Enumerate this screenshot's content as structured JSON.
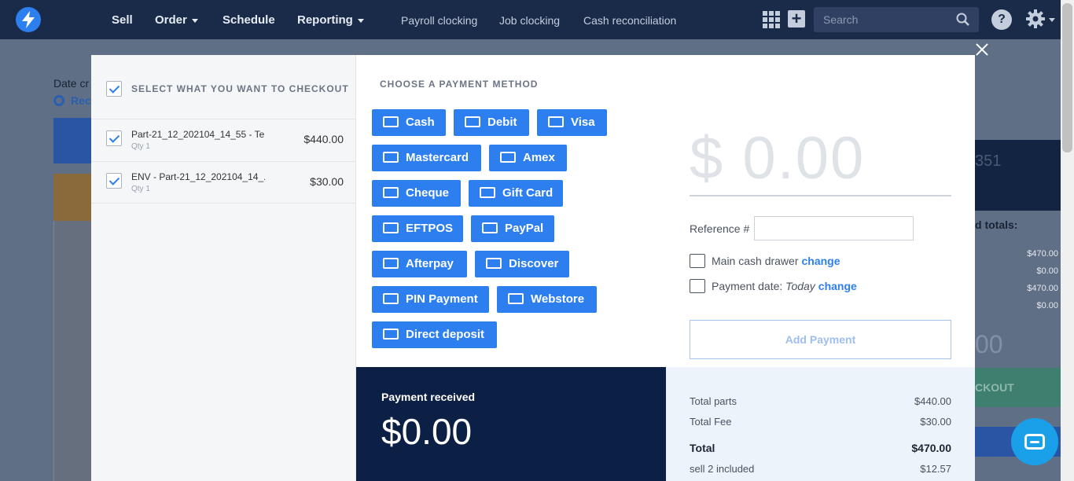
{
  "nav": {
    "main": [
      "Sell",
      "Order",
      "Schedule",
      "Reporting"
    ],
    "sub": [
      "Payroll clocking",
      "Job clocking",
      "Cash reconciliation"
    ],
    "search_placeholder": "Search"
  },
  "background": {
    "date_label": "Date cr",
    "recent_label": "Rec",
    "num_fragment": "351",
    "totals_label": "d totals:",
    "values": [
      "$470.00",
      "$0.00",
      "$470.00",
      "$0.00"
    ],
    "big_fragment": "00",
    "checkout_fragment": "CKOUT"
  },
  "checkout": {
    "heading": "SELECT WHAT YOU WANT TO CHECKOUT",
    "items": [
      {
        "name": "Part-21_12_202104_14_55 - Te...",
        "qty": "Qty 1",
        "price": "$440.00"
      },
      {
        "name": "ENV - Part-21_12_202104_14_...",
        "qty": "Qty 1",
        "price": "$30.00"
      }
    ]
  },
  "payment": {
    "heading": "CHOOSE A PAYMENT METHOD",
    "methods": [
      "Cash",
      "Debit",
      "Visa",
      "Mastercard",
      "Amex",
      "Cheque",
      "Gift Card",
      "EFTPOS",
      "PayPal",
      "Afterpay",
      "Discover",
      "PIN Payment",
      "Webstore",
      "Direct deposit"
    ],
    "amount": "$ 0.00",
    "reference_label": "Reference  #",
    "reference_value": "",
    "drawer_label": "Main cash drawer",
    "change_label": "change",
    "date_prefix": "Payment date:",
    "date_value": "Today",
    "add_payment_label": "Add Payment"
  },
  "received": {
    "label": "Payment received",
    "value": "$0.00"
  },
  "totals": [
    {
      "label": "Total parts",
      "value": "$440.00"
    },
    {
      "label": "Total Fee",
      "value": "$30.00"
    },
    {
      "label": "Total",
      "value": "$470.00"
    },
    {
      "label": "sell 2 included",
      "value": "$12.57"
    }
  ],
  "colors": {
    "accent": "#2d7ff0",
    "nav": "#1a2b4a",
    "received_bg": "#0c1f45"
  }
}
